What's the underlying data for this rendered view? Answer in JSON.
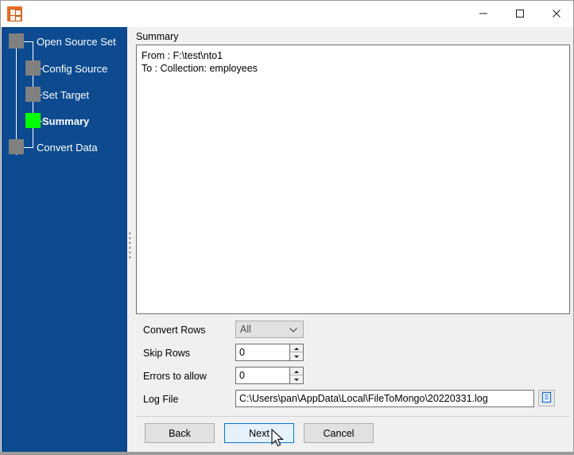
{
  "window": {
    "app_icon": "file-converter-icon",
    "title": "",
    "minimize_label": "Minimize",
    "maximize_label": "Maximize",
    "close_label": "Close",
    "accent_color": "#0d4a8f",
    "active_step_color": "#00ff00",
    "inactive_step_color": "#808080",
    "focus_color": "#0078d7"
  },
  "sidebar": {
    "steps": [
      {
        "label": "Open Source Set",
        "state": "done",
        "active": false
      },
      {
        "label": "Config Source",
        "state": "done",
        "active": false
      },
      {
        "label": "Set Target",
        "state": "done",
        "active": false
      },
      {
        "label": "Summary",
        "state": "active",
        "active": true
      },
      {
        "label": "Convert Data",
        "state": "todo",
        "active": false
      }
    ]
  },
  "main": {
    "summary_label": "Summary",
    "summary_text": "From : F:\\test\\nto1\nTo : Collection: employees",
    "fields": {
      "convert_rows": {
        "label": "Convert Rows",
        "value": "All",
        "options": [
          "All"
        ],
        "dropdown_icon": "chevron-down-icon"
      },
      "skip_rows": {
        "label": "Skip Rows",
        "value": "0",
        "up_icon": "spinner-up-icon",
        "down_icon": "spinner-down-icon"
      },
      "errors_to_allow": {
        "label": "Errors to allow",
        "value": "0",
        "up_icon": "spinner-up-icon",
        "down_icon": "spinner-down-icon"
      },
      "log_file": {
        "label": "Log File",
        "value": "C:\\Users\\pan\\AppData\\Local\\FileToMongo\\20220331.log",
        "browse_icon": "document-browse-icon"
      }
    }
  },
  "footer": {
    "back_label": "Back",
    "next_label": "Next",
    "cancel_label": "Cancel",
    "focused_button": "Next"
  }
}
